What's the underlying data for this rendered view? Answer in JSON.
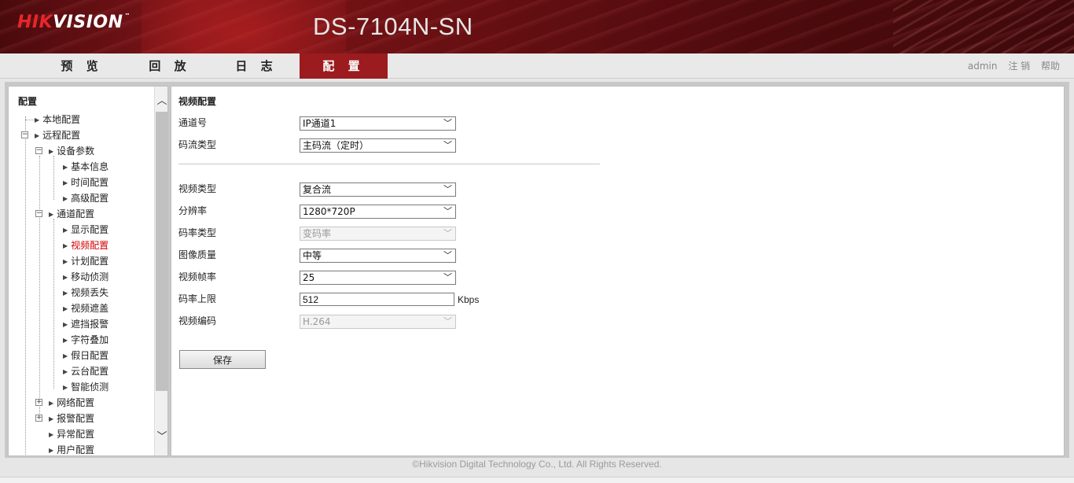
{
  "header": {
    "logo_red": "HIK",
    "logo_white": "VISION",
    "logo_tm": "™",
    "model": "DS-7104N-SN"
  },
  "nav": {
    "tabs": [
      "预 览",
      "回 放",
      "日 志",
      "配 置"
    ],
    "active_tab": "配 置",
    "user": "admin",
    "logout": "注 销",
    "help": "帮助"
  },
  "sidebar": {
    "title": "配置",
    "items": [
      {
        "label": "本地配置"
      },
      {
        "label": "远程配置"
      },
      {
        "label": "设备参数"
      },
      {
        "label": "基本信息"
      },
      {
        "label": "时间配置"
      },
      {
        "label": "高级配置"
      },
      {
        "label": "通道配置"
      },
      {
        "label": "显示配置"
      },
      {
        "label": "视频配置"
      },
      {
        "label": "计划配置"
      },
      {
        "label": "移动侦测"
      },
      {
        "label": "视频丢失"
      },
      {
        "label": "视频遮盖"
      },
      {
        "label": "遮挡报警"
      },
      {
        "label": "字符叠加"
      },
      {
        "label": "假日配置"
      },
      {
        "label": "云台配置"
      },
      {
        "label": "智能侦测"
      },
      {
        "label": "网络配置"
      },
      {
        "label": "报警配置"
      },
      {
        "label": "异常配置"
      },
      {
        "label": "用户配置"
      }
    ],
    "active_item": "视频配置"
  },
  "form": {
    "section_title": "视频配置",
    "channel": {
      "label": "通道号",
      "value": "IP通道1"
    },
    "stream_type": {
      "label": "码流类型",
      "value": "主码流（定时）"
    },
    "video_type": {
      "label": "视频类型",
      "value": "复合流"
    },
    "resolution": {
      "label": "分辨率",
      "value": "1280*720P"
    },
    "bitrate_type": {
      "label": "码率类型",
      "value": "变码率",
      "disabled": true
    },
    "image_quality": {
      "label": "图像质量",
      "value": "中等"
    },
    "frame_rate": {
      "label": "视频帧率",
      "value": "25"
    },
    "max_bitrate": {
      "label": "码率上限",
      "value": "512",
      "unit": "Kbps"
    },
    "encoding": {
      "label": "视频编码",
      "value": "H.264",
      "disabled": true
    },
    "save_label": "保存"
  },
  "footer": {
    "copyright": "©Hikvision Digital Technology Co., Ltd. All Rights Reserved."
  },
  "colors": {
    "brand_red": "#9b1b1f",
    "active_item": "#d40000"
  }
}
